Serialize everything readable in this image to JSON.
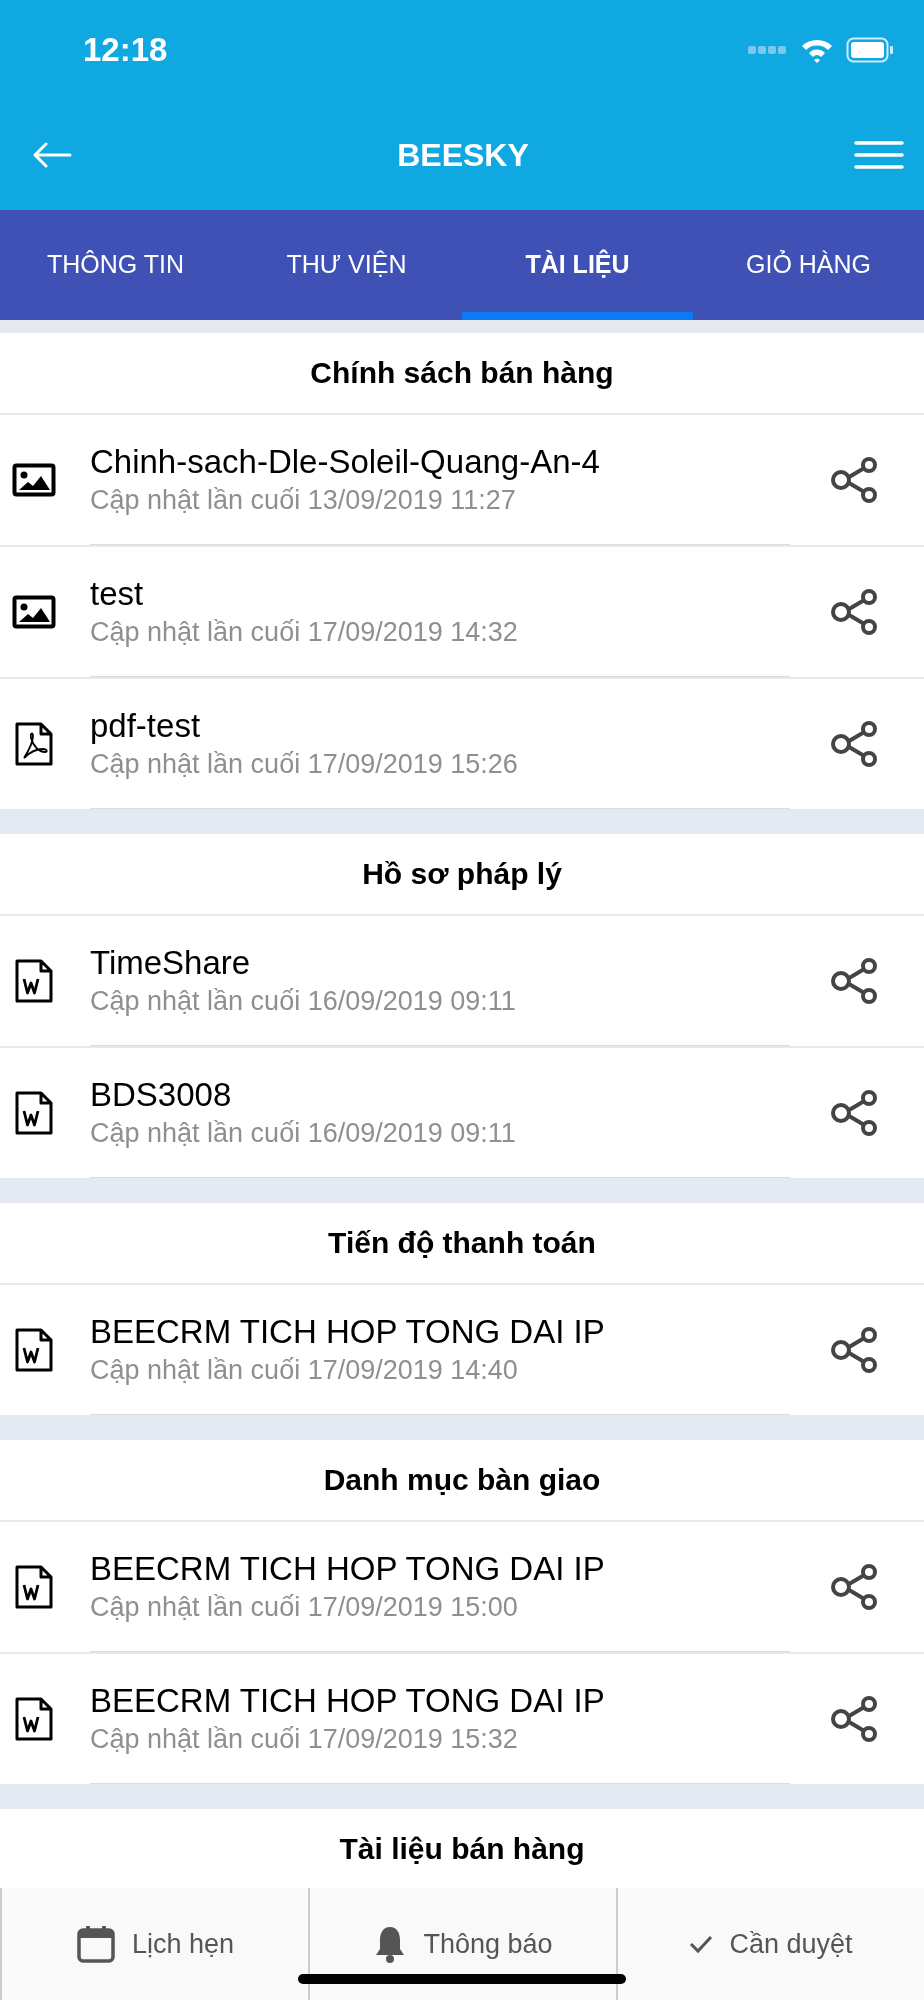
{
  "status_bar": {
    "time": "12:18"
  },
  "header": {
    "title": "BEESKY"
  },
  "tabs": [
    {
      "label": "THÔNG TIN",
      "selected": false
    },
    {
      "label": "THƯ VIỆN",
      "selected": false
    },
    {
      "label": "TÀI LIỆU",
      "selected": true
    },
    {
      "label": "GIỎ HÀNG",
      "selected": false
    }
  ],
  "sections": [
    {
      "title": "Chính sách bán hàng",
      "items": [
        {
          "kind": "image",
          "name": "Chinh-sach-Dle-Soleil-Quang-An-4",
          "updated": "Cập nhật lần cuối 13/09/2019 11:27"
        },
        {
          "kind": "image",
          "name": "test",
          "updated": "Cập nhật lần cuối 17/09/2019 14:32"
        },
        {
          "kind": "pdf",
          "name": "pdf-test",
          "updated": "Cập nhật lần cuối 17/09/2019 15:26"
        }
      ]
    },
    {
      "title": "Hồ sơ pháp lý",
      "items": [
        {
          "kind": "word",
          "name": "TimeShare",
          "updated": "Cập nhật lần cuối 16/09/2019 09:11"
        },
        {
          "kind": "word",
          "name": "BDS3008",
          "updated": "Cập nhật lần cuối 16/09/2019 09:11"
        }
      ]
    },
    {
      "title": "Tiến độ thanh toán",
      "items": [
        {
          "kind": "word",
          "name": "BEECRM TICH HOP TONG DAI IP",
          "updated": "Cập nhật lần cuối 17/09/2019 14:40"
        }
      ]
    },
    {
      "title": "Danh mục bàn giao",
      "items": [
        {
          "kind": "word",
          "name": "BEECRM TICH HOP TONG DAI IP",
          "updated": "Cập nhật lần cuối 17/09/2019 15:00"
        },
        {
          "kind": "word",
          "name": "BEECRM TICH HOP TONG DAI IP",
          "updated": "Cập nhật lần cuối 17/09/2019 15:32"
        }
      ]
    },
    {
      "title": "Tài liệu bán hàng"
    }
  ],
  "bottom_bar": [
    {
      "kind": "calendar",
      "label": "Lịch hẹn"
    },
    {
      "kind": "bell",
      "label": "Thông báo"
    },
    {
      "kind": "check",
      "label": "Cần duyệt"
    }
  ]
}
